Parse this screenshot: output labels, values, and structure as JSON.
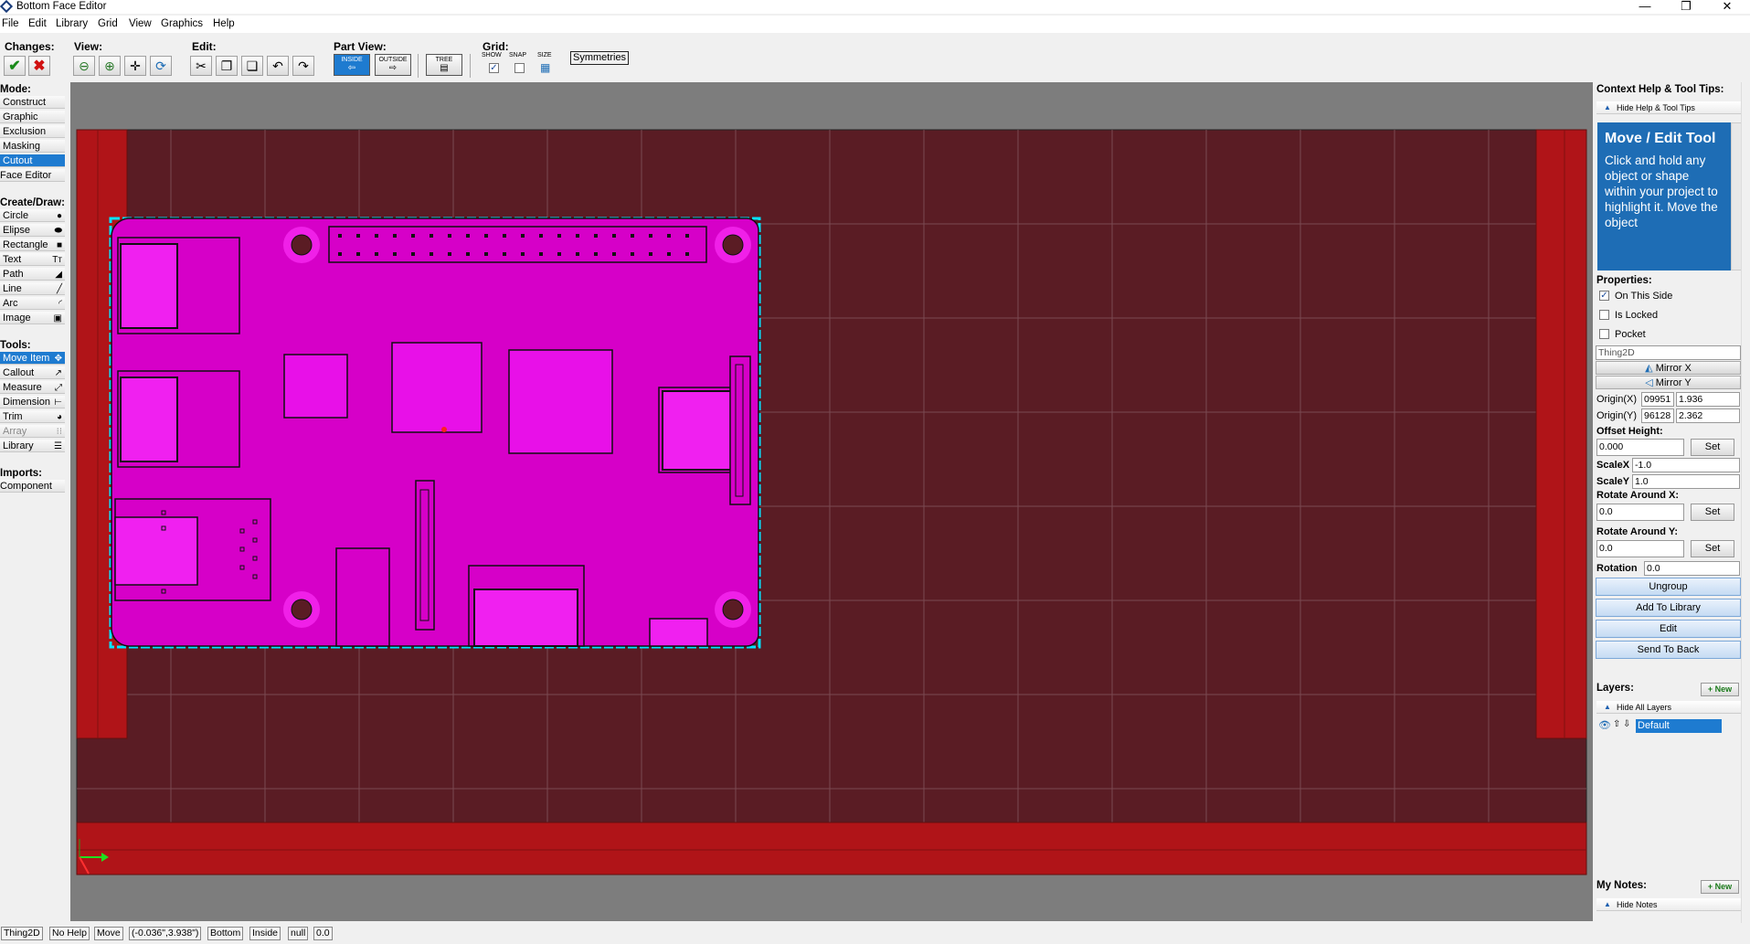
{
  "window": {
    "title": "Bottom Face Editor",
    "minimize": "—",
    "maximize": "❐",
    "close": "✕"
  },
  "menu": [
    "File",
    "Edit",
    "Library",
    "Grid",
    "View",
    "Graphics",
    "Help"
  ],
  "toolbar": {
    "changes_label": "Changes:",
    "view_label": "View:",
    "edit_label": "Edit:",
    "partview_label": "Part View:",
    "inside": "INSIDE",
    "outside": "OUTSIDE",
    "tree": "TREE",
    "grid_label": "Grid:",
    "grid_show": "SHOW",
    "grid_snap": "SNAP",
    "grid_size": "SIZE",
    "grid_show_checked": true,
    "grid_snap_checked": false,
    "symmetries": "Symmetries"
  },
  "left": {
    "mode_label": "Mode:",
    "modes": [
      "Construct",
      "Graphic",
      "Exclusion",
      "Masking",
      "Cutout",
      "Face Editor"
    ],
    "selected_mode": "Cutout",
    "create_label": "Create/Draw:",
    "create": [
      {
        "label": "Circle",
        "icon": "●"
      },
      {
        "label": "Elipse",
        "icon": "⬬"
      },
      {
        "label": "Rectangle",
        "icon": "■"
      },
      {
        "label": "Text",
        "icon": "Tт"
      },
      {
        "label": "Path",
        "icon": "◢"
      },
      {
        "label": "Line",
        "icon": "╱"
      },
      {
        "label": "Arc",
        "icon": "◜"
      },
      {
        "label": "Image",
        "icon": "▣"
      }
    ],
    "tools_label": "Tools:",
    "tools": [
      {
        "label": "Move Item",
        "icon": "✥"
      },
      {
        "label": "Callout",
        "icon": "↗"
      },
      {
        "label": "Measure",
        "icon": "⤢"
      },
      {
        "label": "Dimension",
        "icon": "⊢"
      },
      {
        "label": "Trim",
        "icon": "◕"
      },
      {
        "label": "Array",
        "icon": "⁝⁝"
      },
      {
        "label": "Library",
        "icon": "☰"
      }
    ],
    "selected_tool": "Move Item",
    "imports_label": "Imports:",
    "imports": [
      "Component"
    ]
  },
  "right": {
    "help_label": "Context Help & Tool Tips:",
    "hide_help": "Hide Help & Tool Tips",
    "help_title": "Move / Edit Tool",
    "help_body": "Click and hold any object or shape within your project to highlight it. Move the object",
    "properties_label": "Properties:",
    "on_this_side": "On This Side",
    "on_this_side_checked": true,
    "is_locked": "Is Locked",
    "is_locked_checked": false,
    "pocket": "Pocket",
    "pocket_checked": false,
    "thing": "Thing2D",
    "mirror_x": "Mirror X",
    "mirror_y": "Mirror Y",
    "origin_x_label": "Origin(X)",
    "origin_x_a": "09951",
    "origin_x_b": "1.936",
    "origin_y_label": "Origin(Y)",
    "origin_y_a": "96128",
    "origin_y_b": "2.362",
    "offset_label": "Offset Height:",
    "offset_value": "0.000",
    "set": "Set",
    "scalex_label": "ScaleX",
    "scalex": "-1.0",
    "scaley_label": "ScaleY",
    "scaley": "1.0",
    "rot_x_label": "Rotate Around X:",
    "rot_x": "0.0",
    "rot_y_label": "Rotate Around Y:",
    "rot_y": "0.0",
    "rotation_label": "Rotation",
    "rotation": "0.0",
    "actions": [
      "Ungroup",
      "Add To Library",
      "Edit",
      "Send To Back"
    ],
    "layers_label": "Layers:",
    "new": "+ New",
    "hide_layers": "Hide All Layers",
    "layer_name": "Default",
    "notes_label": "My Notes:",
    "hide_notes": "Hide Notes"
  },
  "status": [
    "Thing2D",
    "No Help",
    "Move",
    "(-0.036\",3.938\")",
    "Bottom",
    "Inside",
    "null",
    "0.0"
  ]
}
